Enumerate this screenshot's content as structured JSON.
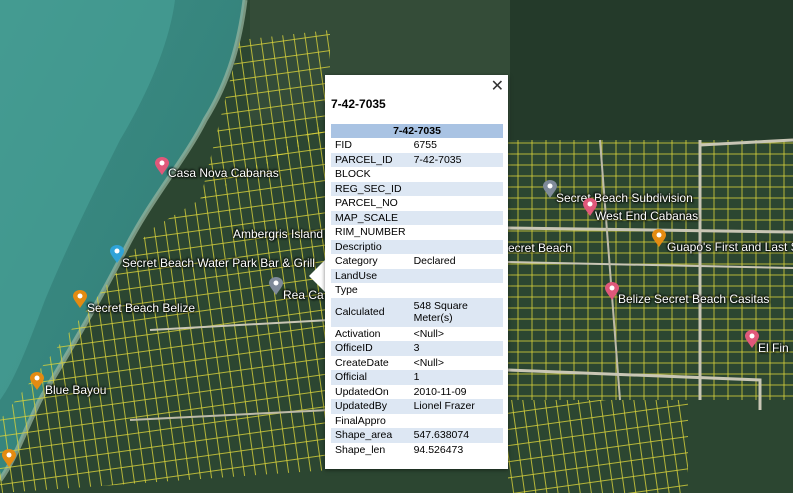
{
  "popup": {
    "close_glyph": "✕",
    "title": "7-42-7035",
    "table_header": "7-42-7035",
    "fields": [
      {
        "key": "FID",
        "value": "6755"
      },
      {
        "key": "PARCEL_ID",
        "value": "7-42-7035"
      },
      {
        "key": "BLOCK",
        "value": ""
      },
      {
        "key": "REG_SEC_ID",
        "value": ""
      },
      {
        "key": "PARCEL_NO",
        "value": ""
      },
      {
        "key": "MAP_SCALE",
        "value": ""
      },
      {
        "key": "RIM_NUMBER",
        "value": ""
      },
      {
        "key": "Descriptio",
        "value": ""
      },
      {
        "key": "Category",
        "value": "Declared"
      },
      {
        "key": "LandUse",
        "value": ""
      },
      {
        "key": "Type",
        "value": ""
      },
      {
        "key": "Calculated",
        "value": "548 Square Meter(s)"
      },
      {
        "key": "Activation",
        "value": "<Null>"
      },
      {
        "key": "OfficeID",
        "value": "3"
      },
      {
        "key": "CreateDate",
        "value": "<Null>"
      },
      {
        "key": "Official",
        "value": "1"
      },
      {
        "key": "UpdatedOn",
        "value": "2010-11-09"
      },
      {
        "key": "UpdatedBy",
        "value": "Lionel Frazer"
      },
      {
        "key": "FinalAppro",
        "value": ""
      },
      {
        "key": "Shape_area",
        "value": "547.638074"
      },
      {
        "key": "Shape_len",
        "value": "94.526473"
      }
    ]
  },
  "places": [
    {
      "name": "Casa Nova Cabanas",
      "icon": "hotel-pin-icon",
      "color": "#e0587a"
    },
    {
      "name": "Ambergris Island",
      "icon": "",
      "color": ""
    },
    {
      "name": "Secret Beach Water Park Bar & Grill",
      "icon": "drink-pin-icon",
      "color": "#2fa3d8"
    },
    {
      "name": "Rea Ca",
      "icon": "place-pin-icon",
      "color": "#7f8a99"
    },
    {
      "name": "Secret Beach Belize",
      "icon": "food-pin-icon",
      "color": "#e38b12"
    },
    {
      "name": "Blue Bayou",
      "icon": "food-pin-icon",
      "color": "#e38b12"
    },
    {
      "name": "Secret Beach Subdivision",
      "icon": "place-pin-icon",
      "color": "#7f8a99"
    },
    {
      "name": "West End Cabanas",
      "icon": "hotel-pin-icon",
      "color": "#e0587a"
    },
    {
      "name": "ecret Beach",
      "icon": "",
      "color": ""
    },
    {
      "name": "Guapo's First and Last S",
      "icon": "food-pin-icon",
      "color": "#e38b12"
    },
    {
      "name": "Belize Secret Beach Casitas",
      "icon": "hotel-pin-icon",
      "color": "#e0587a"
    },
    {
      "name": "El Fin",
      "icon": "hotel-pin-icon",
      "color": "#e0587a"
    }
  ]
}
